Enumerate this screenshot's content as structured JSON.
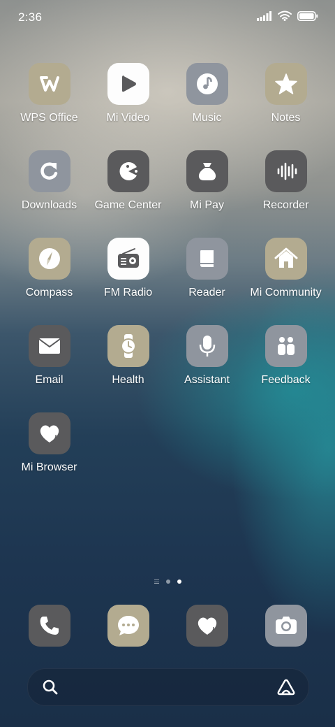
{
  "status_bar": {
    "time": "2:36"
  },
  "apps": [
    {
      "label": "WPS Office",
      "icon": "wps-office-icon",
      "color": "#b3ab90"
    },
    {
      "label": "Mi Video",
      "icon": "play-icon",
      "color": "#fdfdfd"
    },
    {
      "label": "Music",
      "icon": "music-note-icon",
      "color": "#8f959e"
    },
    {
      "label": "Notes",
      "icon": "star-icon",
      "color": "#b3ab90"
    },
    {
      "label": "Downloads",
      "icon": "refresh-arrow-icon",
      "color": "#8f959e"
    },
    {
      "label": "Game Center",
      "icon": "pacman-icon",
      "color": "#5a5a5c"
    },
    {
      "label": "Mi Pay",
      "icon": "money-bag-icon",
      "color": "#5a5a5c"
    },
    {
      "label": "Recorder",
      "icon": "waveform-icon",
      "color": "#5a5a5c"
    },
    {
      "label": "Compass",
      "icon": "compass-icon",
      "color": "#b3ab90"
    },
    {
      "label": "FM Radio",
      "icon": "radio-icon",
      "color": "#fdfdfd"
    },
    {
      "label": "Reader",
      "icon": "book-icon",
      "color": "#8f959e"
    },
    {
      "label": "Mi Community",
      "icon": "home-icon",
      "color": "#b3ab90"
    },
    {
      "label": "Email",
      "icon": "envelope-icon",
      "color": "#5a5a5c"
    },
    {
      "label": "Health",
      "icon": "watch-icon",
      "color": "#b3ab90"
    },
    {
      "label": "Assistant",
      "icon": "microphone-icon",
      "color": "#8f959e"
    },
    {
      "label": "Feedback",
      "icon": "people-icon",
      "color": "#8f959e"
    },
    {
      "label": "Mi Browser",
      "icon": "heart-icon",
      "color": "#5a5a5c"
    }
  ],
  "page_indicator": {
    "pages": 2,
    "current": 2
  },
  "dock": [
    {
      "name": "phone",
      "icon": "phone-icon",
      "color": "#5a5a5c"
    },
    {
      "name": "messaging",
      "icon": "chat-bubble-icon",
      "color": "#b3ab90"
    },
    {
      "name": "browser",
      "icon": "heart-icon",
      "color": "#5a5a5c"
    },
    {
      "name": "camera",
      "icon": "camera-icon",
      "color": "#8f959e"
    }
  ],
  "search_bar": {
    "left_icon": "search-icon",
    "right_icon": "lens-icon"
  }
}
